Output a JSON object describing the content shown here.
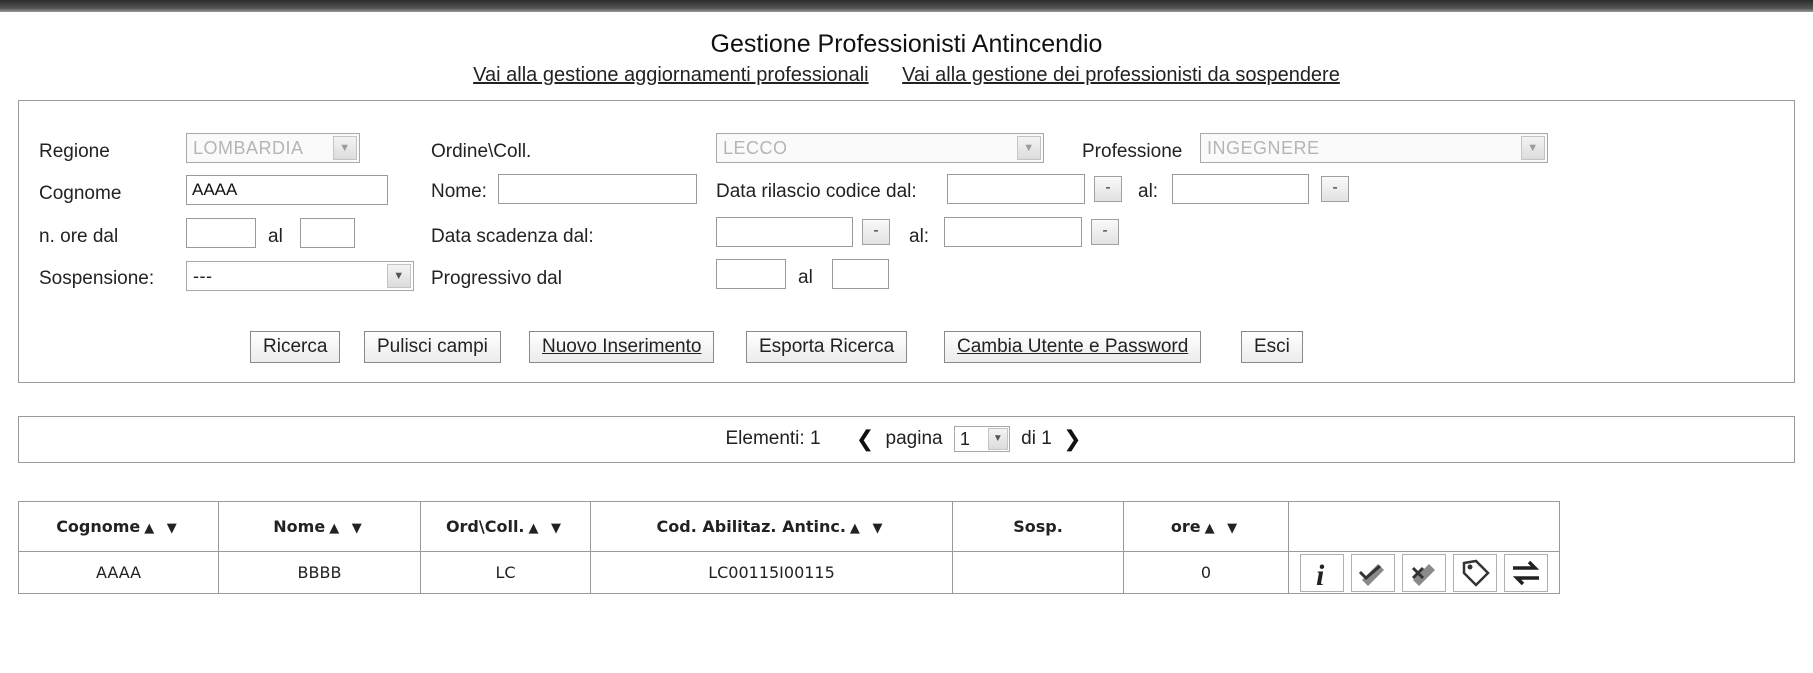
{
  "header": {
    "title": "Gestione Professionisti Antincendio",
    "link_aggiornamenti": "Vai alla gestione aggiornamenti professionali",
    "link_sospendere": "Vai alla gestione dei professionisti da sospendere"
  },
  "search": {
    "regione_label": "Regione",
    "regione_value": "LOMBARDIA",
    "ordine_label": "Ordine\\Coll.",
    "ordine_value": "LECCO",
    "professione_label": "Professione",
    "professione_value": "INGEGNERE",
    "cognome_label": "Cognome",
    "cognome_value": "AAAA",
    "nome_label": "Nome:",
    "nome_value": "",
    "rilascio_label": "Data rilascio codice dal:",
    "rilascio_dal_value": "",
    "rilascio_al_label": "al:",
    "rilascio_al_value": "",
    "ore_label": "n. ore dal",
    "ore_dal_value": "",
    "ore_al_label": "al",
    "ore_al_value": "",
    "scadenza_label": "Data scadenza dal:",
    "scadenza_dal_value": "",
    "scadenza_al_label": "al:",
    "scadenza_al_value": "",
    "sospensione_label": "Sospensione:",
    "sospensione_value": "---",
    "progressivo_label": "Progressivo dal",
    "progressivo_dal_value": "",
    "progressivo_al_label": "al",
    "progressivo_al_value": "",
    "date_button": "-"
  },
  "actions": {
    "ricerca": "Ricerca",
    "pulisci": "Pulisci campi",
    "nuovo": "Nuovo Inserimento",
    "esporta": "Esporta Ricerca",
    "cambia": "Cambia Utente e Password",
    "esci": "Esci"
  },
  "pager": {
    "elementi_label": "Elementi: 1",
    "pagina_label": "pagina",
    "page_value": "1",
    "di_label": "di 1",
    "prev_icon": "chevron-left-icon",
    "next_icon": "chevron-right-icon"
  },
  "table": {
    "columns": [
      "Cognome",
      "Nome",
      "Ord\\Coll.",
      "Cod. Abilitaz. Antinc.",
      "Sosp.",
      "ore",
      ""
    ],
    "sort_arrows": "▲ ▼",
    "rows": [
      {
        "cognome": "AAAA",
        "nome": "BBBB",
        "ord": "LC",
        "cod": "LC00115I00115",
        "sosp": "",
        "ore": "0",
        "actions": [
          "info-icon",
          "check-edit-icon",
          "cancel-edit-icon",
          "tag-icon",
          "transfer-icon"
        ]
      }
    ]
  }
}
